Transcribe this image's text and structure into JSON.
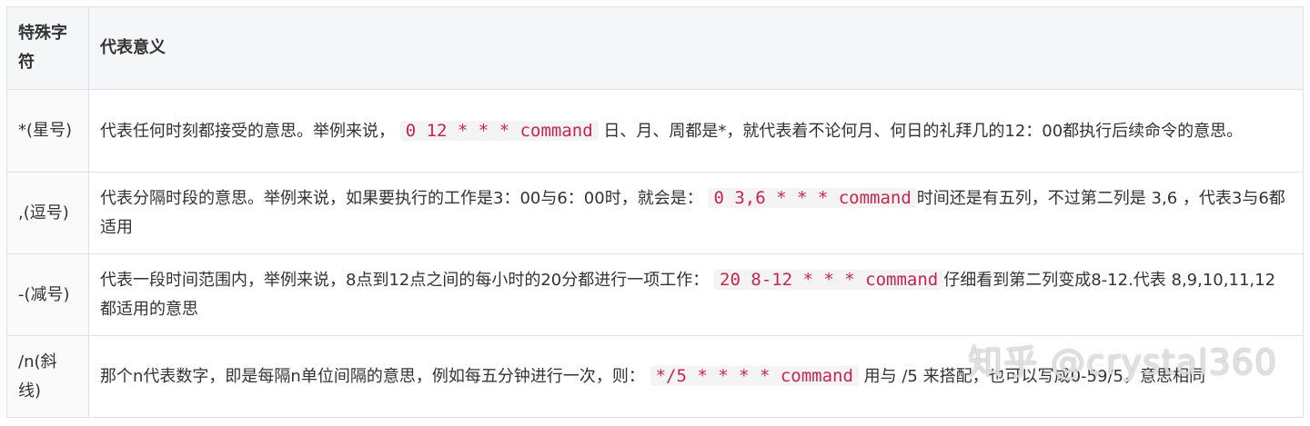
{
  "table": {
    "headers": [
      "特殊字符",
      "代表意义"
    ],
    "rows": [
      {
        "char": "*(星号)",
        "before": "代表任何时刻都接受的意思。举例来说，",
        "code": "0 12 * * * command",
        "after": "日、月、周都是*，就代表着不论何月、何日的礼拜几的12：00都执行后续命令的意思。"
      },
      {
        "char": ",(逗号)",
        "before": "代表分隔时段的意思。举例来说，如果要执行的工作是3：00与6：00时，就会是：",
        "code": "0 3,6 * * * command",
        "after": "时间还是有五列，不过第二列是 3,6 ，代表3与6都适用"
      },
      {
        "char": "-(减号)",
        "before": "代表一段时间范围内，举例来说，8点到12点之间的每小时的20分都进行一项工作：",
        "code": "20 8-12 * * * command",
        "after": "仔细看到第二列变成8-12.代表 8,9,10,11,12 都适用的意思"
      },
      {
        "char": "/n(斜线)",
        "before": "那个n代表数字，即是每隔n单位间隔的意思，例如每五分钟进行一次，则：",
        "code": "*/5 * * * * command",
        "after": "用与 /5 来搭配，也可以写成0-59/5，意思相同"
      }
    ]
  },
  "watermark": "知乎 @crystal360",
  "colors": {
    "header_bg": "#f5f6f7",
    "border": "#dfe2e5",
    "code_text": "#c7254e",
    "code_bg": "#f4f4f5",
    "text": "#333333"
  }
}
